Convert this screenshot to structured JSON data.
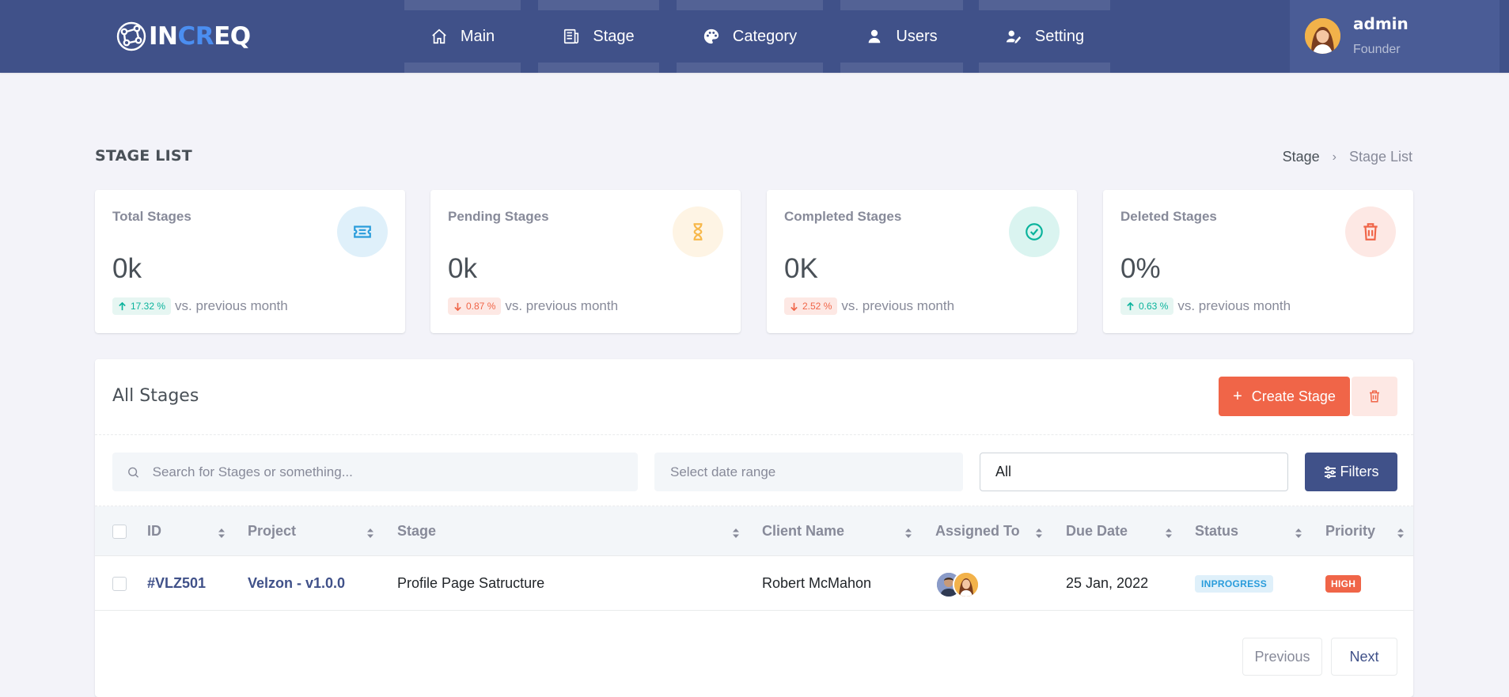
{
  "app": {
    "logo_prefix": "IN",
    "logo_accent": "CR",
    "logo_suffix": "EQ"
  },
  "nav": {
    "items": [
      {
        "label": "Main",
        "icon": "home-icon"
      },
      {
        "label": "Stage",
        "icon": "newspaper-icon"
      },
      {
        "label": "Category",
        "icon": "palette-icon"
      },
      {
        "label": "Users",
        "icon": "user-icon"
      },
      {
        "label": "Setting",
        "icon": "settings-icon"
      }
    ]
  },
  "user": {
    "name": "admin",
    "role": "Founder"
  },
  "page": {
    "title": "STAGE LIST",
    "breadcrumb": [
      "Stage",
      "Stage List"
    ]
  },
  "stats": [
    {
      "label": "Total Stages",
      "value": "0k",
      "change": "17.32 %",
      "trend": "up",
      "suffix": "vs. previous month",
      "icon": "ticket-icon",
      "color": "#299cdb"
    },
    {
      "label": "Pending Stages",
      "value": "0k",
      "change": "0.87 %",
      "trend": "down",
      "suffix": "vs. previous month",
      "icon": "hourglass-icon",
      "color": "#f7b84b"
    },
    {
      "label": "Completed Stages",
      "value": "0K",
      "change": "2.52 %",
      "trend": "down",
      "suffix": "vs. previous month",
      "icon": "check-circle-icon",
      "color": "#0ab39c"
    },
    {
      "label": "Deleted Stages",
      "value": "0%",
      "change": "0.63 %",
      "trend": "up",
      "suffix": "vs. previous month",
      "icon": "trash-icon",
      "color": "#f06548"
    }
  ],
  "card": {
    "title": "All Stages",
    "create_label": "Create Stage",
    "filters_label": "Filters",
    "search_placeholder": "Search for Stages or something...",
    "date_placeholder": "Select date range",
    "status_selected": "All"
  },
  "table": {
    "columns": [
      "ID",
      "Project",
      "Stage",
      "Client Name",
      "Assigned To",
      "Due Date",
      "Status",
      "Priority"
    ],
    "rows": [
      {
        "id": "#VLZ501",
        "project": "Velzon - v1.0.0",
        "stage": "Profile Page Satructure",
        "client": "Robert McMahon",
        "due": "25 Jan, 2022",
        "status": "INPROGRESS",
        "priority": "HIGH"
      }
    ]
  },
  "pagination": {
    "prev_label": "Previous",
    "next_label": "Next"
  },
  "colors": {
    "primary": "#405189",
    "danger": "#f06548",
    "success": "#0ab39c",
    "warning": "#f7b84b",
    "info": "#299cdb"
  }
}
